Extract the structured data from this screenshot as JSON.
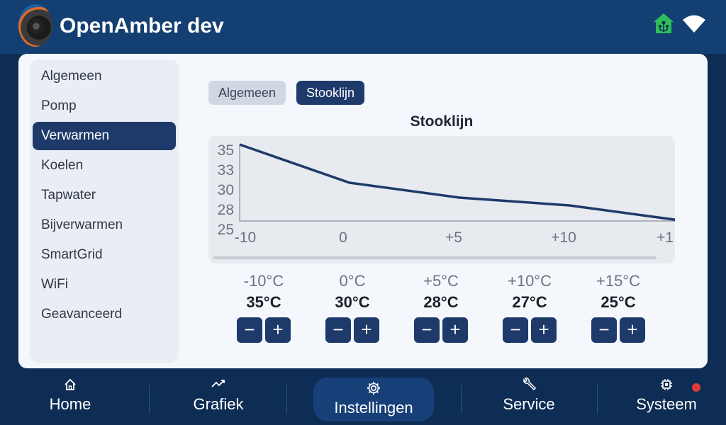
{
  "header": {
    "title": "OpenAmber dev",
    "icons": [
      "home-network-icon",
      "wifi-icon"
    ],
    "home_icon_color": "#2fbf5a"
  },
  "sidebar": {
    "items": [
      {
        "label": "Algemeen"
      },
      {
        "label": "Pomp"
      },
      {
        "label": "Verwarmen",
        "active": true
      },
      {
        "label": "Koelen"
      },
      {
        "label": "Tapwater"
      },
      {
        "label": "Bijverwarmen"
      },
      {
        "label": "SmartGrid"
      },
      {
        "label": "WiFi"
      },
      {
        "label": "Geavanceerd"
      }
    ]
  },
  "tabs": {
    "inactive_label": "Algemeen",
    "active_label": "Stooklijn"
  },
  "chart_title": "Stooklijn",
  "chart_data": {
    "type": "line",
    "title": "Stooklijn",
    "x": [
      -10,
      0,
      5,
      10,
      15
    ],
    "x_tick_labels": [
      "-10",
      "0",
      "+5",
      "+10",
      "+1"
    ],
    "y_tick_labels": [
      "35",
      "33",
      "30",
      "28",
      "25"
    ],
    "ylim": [
      25,
      35
    ],
    "series": [
      {
        "values": [
          35,
          30,
          28,
          27,
          25
        ]
      }
    ],
    "line_color": "#1e3a6a",
    "grid": false
  },
  "steppers": [
    {
      "label": "-10°C",
      "value": "35°C"
    },
    {
      "label": "0°C",
      "value": "30°C"
    },
    {
      "label": "+5°C",
      "value": "28°C"
    },
    {
      "label": "+10°C",
      "value": "27°C"
    },
    {
      "label": "+15°C",
      "value": "25°C"
    }
  ],
  "stepper_symbols": {
    "minus": "−",
    "plus": "+"
  },
  "nav": {
    "home": "Home",
    "grafiek": "Grafiek",
    "instellingen": "Instellingen",
    "service": "Service",
    "systeem": "Systeem"
  },
  "colors": {
    "accent": "#1e3a6a",
    "alert": "#e23a3a"
  }
}
